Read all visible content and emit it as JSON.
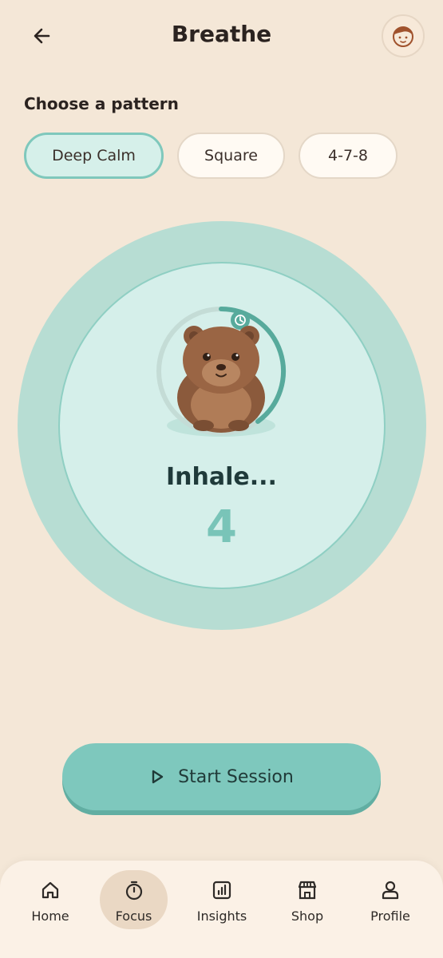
{
  "header": {
    "title": "Breathe"
  },
  "patterns": {
    "label": "Choose a pattern",
    "options": [
      "Deep Calm",
      "Square",
      "4-7-8"
    ],
    "selected": "Deep Calm"
  },
  "breathing": {
    "phase": "Inhale...",
    "count": "4"
  },
  "start_button": {
    "label": "Start Session",
    "icon": "play-icon"
  },
  "nav": {
    "items": [
      {
        "label": "Home",
        "icon": "home-icon"
      },
      {
        "label": "Focus",
        "icon": "stopwatch-icon"
      },
      {
        "label": "Insights",
        "icon": "chart-icon"
      },
      {
        "label": "Shop",
        "icon": "store-icon"
      },
      {
        "label": "Profile",
        "icon": "user-icon"
      }
    ],
    "active": "Focus"
  },
  "colors": {
    "background": "#f4e7d7",
    "accent": "#7ec8bd",
    "accent_light": "#d5efea",
    "count_color": "#79c4b8"
  }
}
